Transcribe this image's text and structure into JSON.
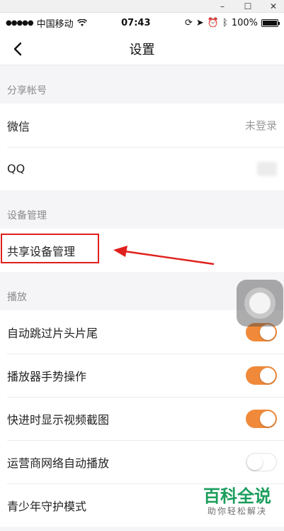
{
  "window_controls": {
    "minimize": "–",
    "maximize": "☐",
    "close": "✕"
  },
  "status": {
    "carrier": "中国移动",
    "time": "07:43",
    "battery": "100%"
  },
  "nav": {
    "title": "设置",
    "back_icon": "chevron-left-icon"
  },
  "sections": {
    "share": {
      "header": "分享帐号",
      "wechat": {
        "label": "微信",
        "value": "未登录"
      },
      "qq": {
        "label": "QQ"
      }
    },
    "device": {
      "header": "设备管理",
      "shared_devices": {
        "label": "共享设备管理"
      }
    },
    "playback": {
      "header": "播放",
      "items": [
        {
          "label": "自动跳过片头片尾",
          "on": true
        },
        {
          "label": "播放器手势操作",
          "on": true
        },
        {
          "label": "快进时显示视频截图",
          "on": true
        },
        {
          "label": "运营商网络自动播放",
          "on": false
        },
        {
          "label": "青少年守护模式"
        }
      ]
    }
  },
  "watermark": {
    "main": "百科全说",
    "sub": "助你轻松解决"
  },
  "colors": {
    "accent": "#f08a3a",
    "annotation": "#e0201c",
    "watermark": "#1a9e5c"
  }
}
